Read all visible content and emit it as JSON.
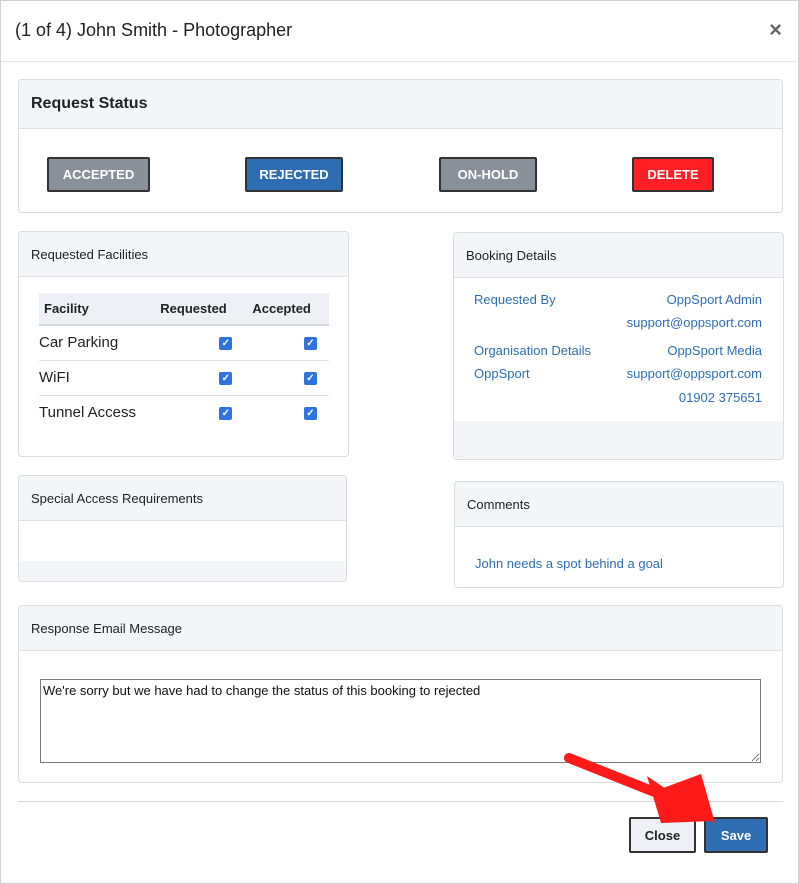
{
  "modal": {
    "title": "(1 of 4) John Smith - Photographer",
    "close_symbol": "×"
  },
  "request_status": {
    "heading": "Request Status",
    "buttons": {
      "accepted": "ACCEPTED",
      "rejected": "REJECTED",
      "on_hold": "ON-HOLD",
      "delete": "DELETE"
    },
    "colors": {
      "accepted": "#8a9099",
      "rejected": "#2f6db3",
      "on_hold": "#8a9099",
      "delete": "#ff1f24"
    }
  },
  "facilities": {
    "heading": "Requested Facilities",
    "columns": [
      "Facility",
      "Requested",
      "Accepted"
    ],
    "rows": [
      {
        "name": "Car Parking",
        "requested": true,
        "accepted": true
      },
      {
        "name": "WiFI",
        "requested": true,
        "accepted": true
      },
      {
        "name": "Tunnel Access",
        "requested": true,
        "accepted": true
      }
    ]
  },
  "booking_details": {
    "heading": "Booking Details",
    "requested_by_label": "Requested By",
    "requested_by_name": "OppSport Admin",
    "requested_by_email": "support@oppsport.com",
    "org_label": "Organisation Details",
    "org_label_name": "OppSport",
    "org_name": "OppSport Media",
    "org_email": "support@oppsport.com",
    "org_phone": "01902 375651"
  },
  "special_access": {
    "heading": "Special Access Requirements"
  },
  "comments": {
    "heading": "Comments",
    "text": "John needs a spot behind a goal"
  },
  "response_email": {
    "heading": "Response Email Message",
    "message": "We're sorry but we have had to change the status of this booking to rejected"
  },
  "footer": {
    "close_label": "Close",
    "save_label": "Save"
  },
  "accent_colors": {
    "link": "#2f6db3",
    "annotation_arrow": "#ff1a1a"
  }
}
